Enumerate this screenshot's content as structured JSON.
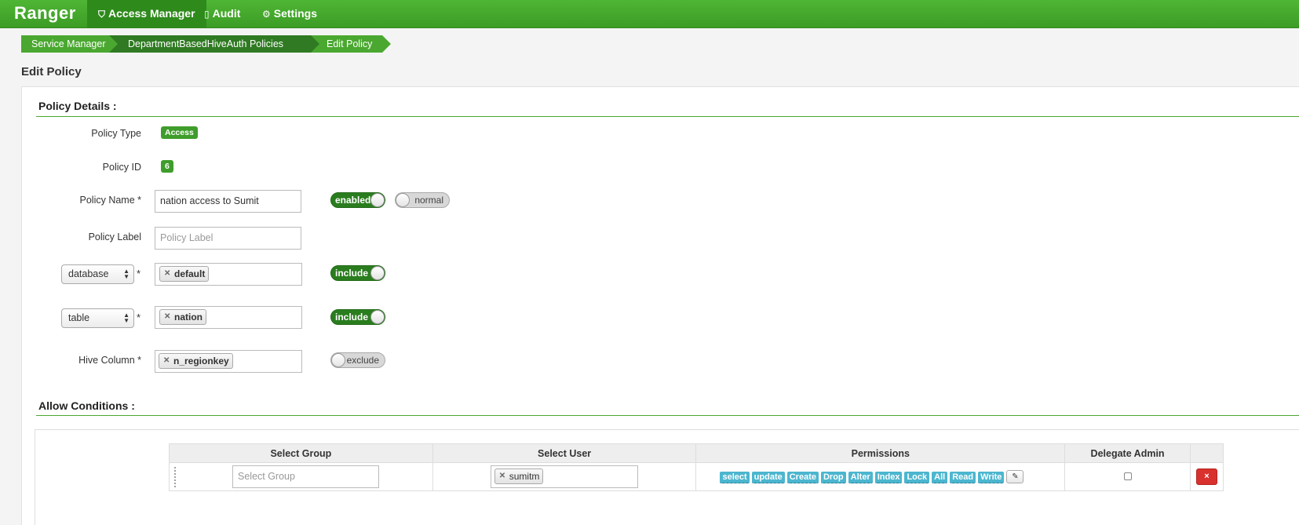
{
  "nav": {
    "brand": "Ranger",
    "items": [
      {
        "label": "Access Manager",
        "icon": "shield-icon"
      },
      {
        "label": "Audit",
        "icon": "document-icon"
      },
      {
        "label": "Settings",
        "icon": "gear-icon"
      }
    ]
  },
  "breadcrumb": [
    "Service Manager",
    "DepartmentBasedHiveAuth Policies",
    "Edit Policy"
  ],
  "page_title": "Edit Policy",
  "policy_details": {
    "title": "Policy Details :",
    "policy_type_label": "Policy Type",
    "policy_type_value": "Access",
    "policy_id_label": "Policy ID",
    "policy_id_value": "6",
    "policy_name_label": "Policy Name *",
    "policy_name_value": "nation access to Sumit",
    "enabled_toggle": "enabled",
    "normal_toggle": "normal",
    "policy_label_label": "Policy Label",
    "policy_label_placeholder": "Policy Label",
    "resources": [
      {
        "type": "database",
        "value": "default",
        "toggle": "include"
      },
      {
        "type": "table",
        "value": "nation",
        "toggle": "include"
      }
    ],
    "column_label": "Hive Column *",
    "column_value": "n_regionkey",
    "column_toggle": "exclude",
    "required_star": "*"
  },
  "allow_conditions": {
    "title": "Allow Conditions :",
    "columns": [
      "Select Group",
      "Select User",
      "Permissions",
      "Delegate Admin"
    ],
    "row": {
      "group_placeholder": "Select Group",
      "user": "sumitm",
      "permissions": [
        "select",
        "update",
        "Create",
        "Drop",
        "Alter",
        "Index",
        "Lock",
        "All",
        "Read",
        "Write"
      ],
      "delete_label": "×"
    }
  },
  "colors": {
    "brand_green": "#3c9c25",
    "dark_green": "#2f7a22",
    "permission_blue": "#4cb6cf",
    "delete_red": "#d9312d"
  }
}
